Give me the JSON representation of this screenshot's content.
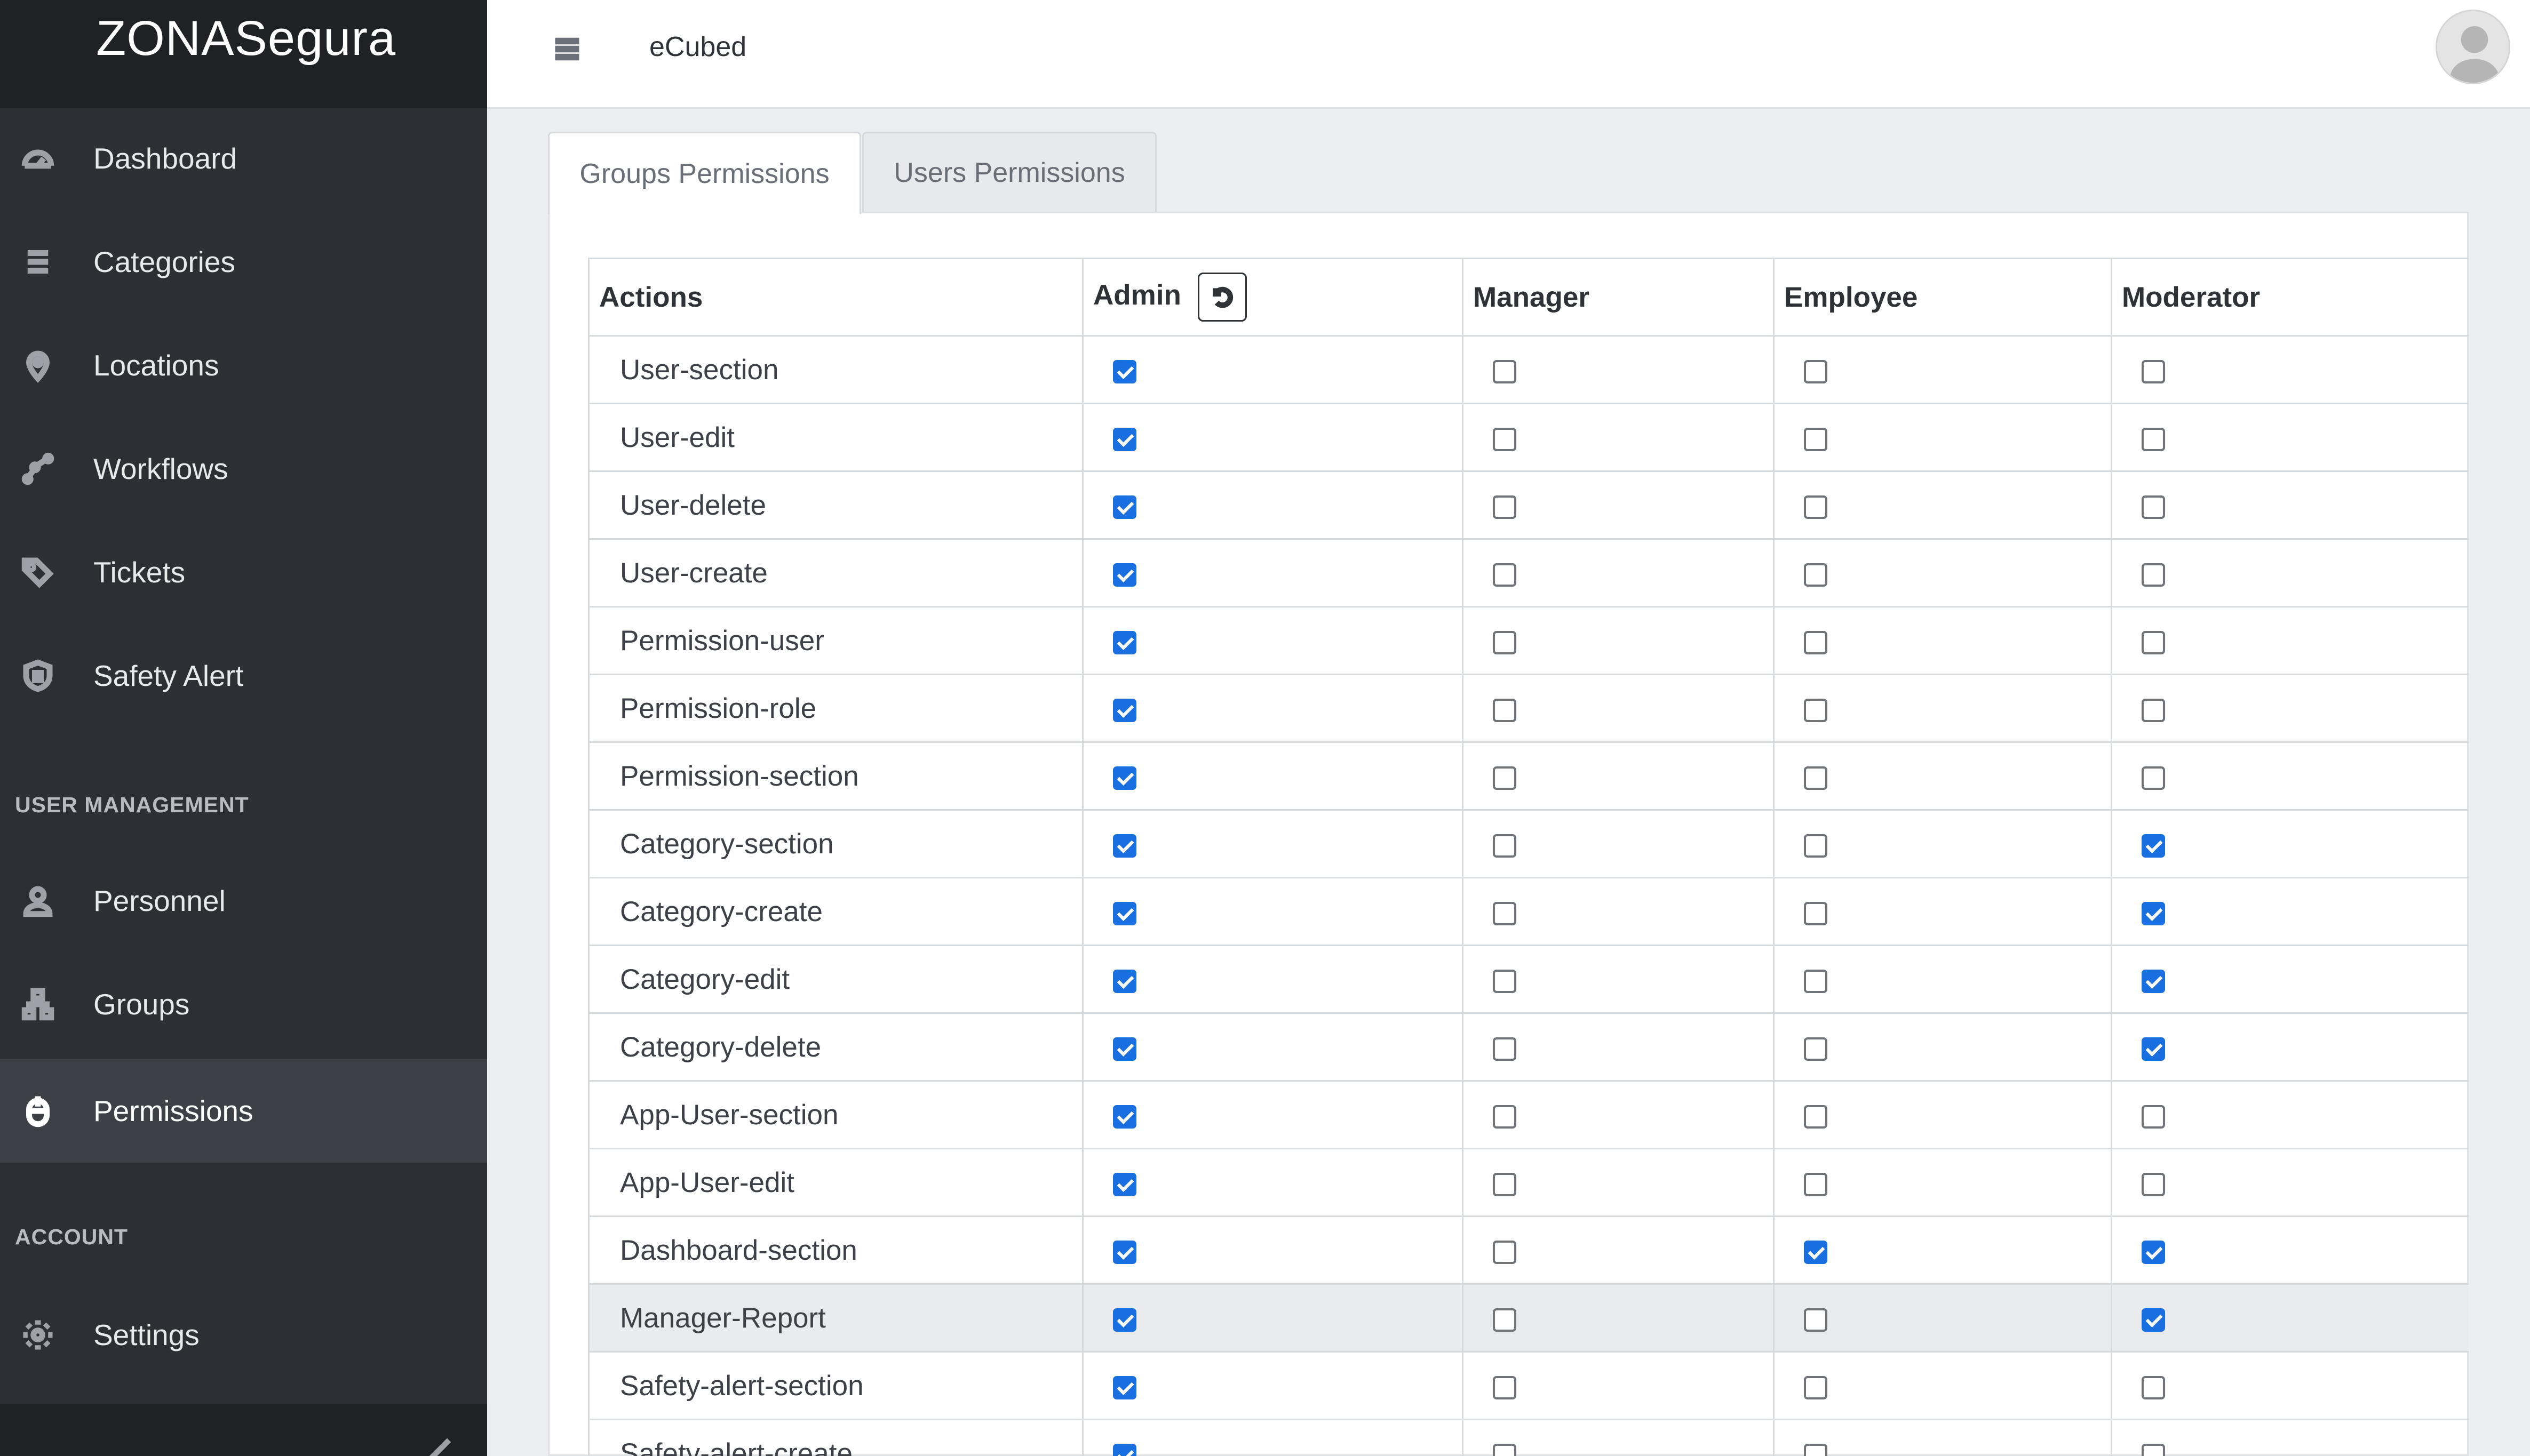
{
  "app": {
    "brand": "ZONASegura"
  },
  "header": {
    "org_name": "eCubed"
  },
  "sidebar": {
    "items": [
      {
        "label": "Dashboard",
        "icon": "gauge-icon"
      },
      {
        "label": "Categories",
        "icon": "list-icon"
      },
      {
        "label": "Locations",
        "icon": "map-pin-icon"
      },
      {
        "label": "Workflows",
        "icon": "workflow-icon"
      },
      {
        "label": "Tickets",
        "icon": "tags-icon"
      },
      {
        "label": "Safety Alert",
        "icon": "shield-icon"
      }
    ],
    "user_management_label": "USER MANAGEMENT",
    "user_management_items": [
      {
        "label": "Personnel",
        "icon": "person-icon"
      },
      {
        "label": "Groups",
        "icon": "hierarchy-icon"
      },
      {
        "label": "Permissions",
        "icon": "mouse-icon",
        "active": true
      }
    ],
    "account_label": "ACCOUNT",
    "account_items": [
      {
        "label": "Settings",
        "icon": "gear-icon"
      }
    ]
  },
  "tabs": [
    {
      "label": "Groups Permissions",
      "active": true
    },
    {
      "label": "Users Permissions",
      "active": false
    }
  ],
  "table": {
    "headers": {
      "actions": "Actions",
      "admin": "Admin",
      "manager": "Manager",
      "employee": "Employee",
      "moderator": "Moderator"
    },
    "rows": [
      {
        "action": "User-section",
        "admin": true,
        "manager": false,
        "employee": false,
        "moderator": false
      },
      {
        "action": "User-edit",
        "admin": true,
        "manager": false,
        "employee": false,
        "moderator": false
      },
      {
        "action": "User-delete",
        "admin": true,
        "manager": false,
        "employee": false,
        "moderator": false
      },
      {
        "action": "User-create",
        "admin": true,
        "manager": false,
        "employee": false,
        "moderator": false
      },
      {
        "action": "Permission-user",
        "admin": true,
        "manager": false,
        "employee": false,
        "moderator": false
      },
      {
        "action": "Permission-role",
        "admin": true,
        "manager": false,
        "employee": false,
        "moderator": false
      },
      {
        "action": "Permission-section",
        "admin": true,
        "manager": false,
        "employee": false,
        "moderator": false
      },
      {
        "action": "Category-section",
        "admin": true,
        "manager": false,
        "employee": false,
        "moderator": true
      },
      {
        "action": "Category-create",
        "admin": true,
        "manager": false,
        "employee": false,
        "moderator": true
      },
      {
        "action": "Category-edit",
        "admin": true,
        "manager": false,
        "employee": false,
        "moderator": true
      },
      {
        "action": "Category-delete",
        "admin": true,
        "manager": false,
        "employee": false,
        "moderator": true
      },
      {
        "action": "App-User-section",
        "admin": true,
        "manager": false,
        "employee": false,
        "moderator": false
      },
      {
        "action": "App-User-edit",
        "admin": true,
        "manager": false,
        "employee": false,
        "moderator": false
      },
      {
        "action": "Dashboard-section",
        "admin": true,
        "manager": false,
        "employee": true,
        "moderator": true
      },
      {
        "action": "Manager-Report",
        "admin": true,
        "manager": false,
        "employee": false,
        "moderator": true,
        "highlighted": true
      },
      {
        "action": "Safety-alert-section",
        "admin": true,
        "manager": false,
        "employee": false,
        "moderator": false
      },
      {
        "action": "Safety-alert-create",
        "admin": true,
        "manager": false,
        "employee": false,
        "moderator": false
      }
    ]
  }
}
